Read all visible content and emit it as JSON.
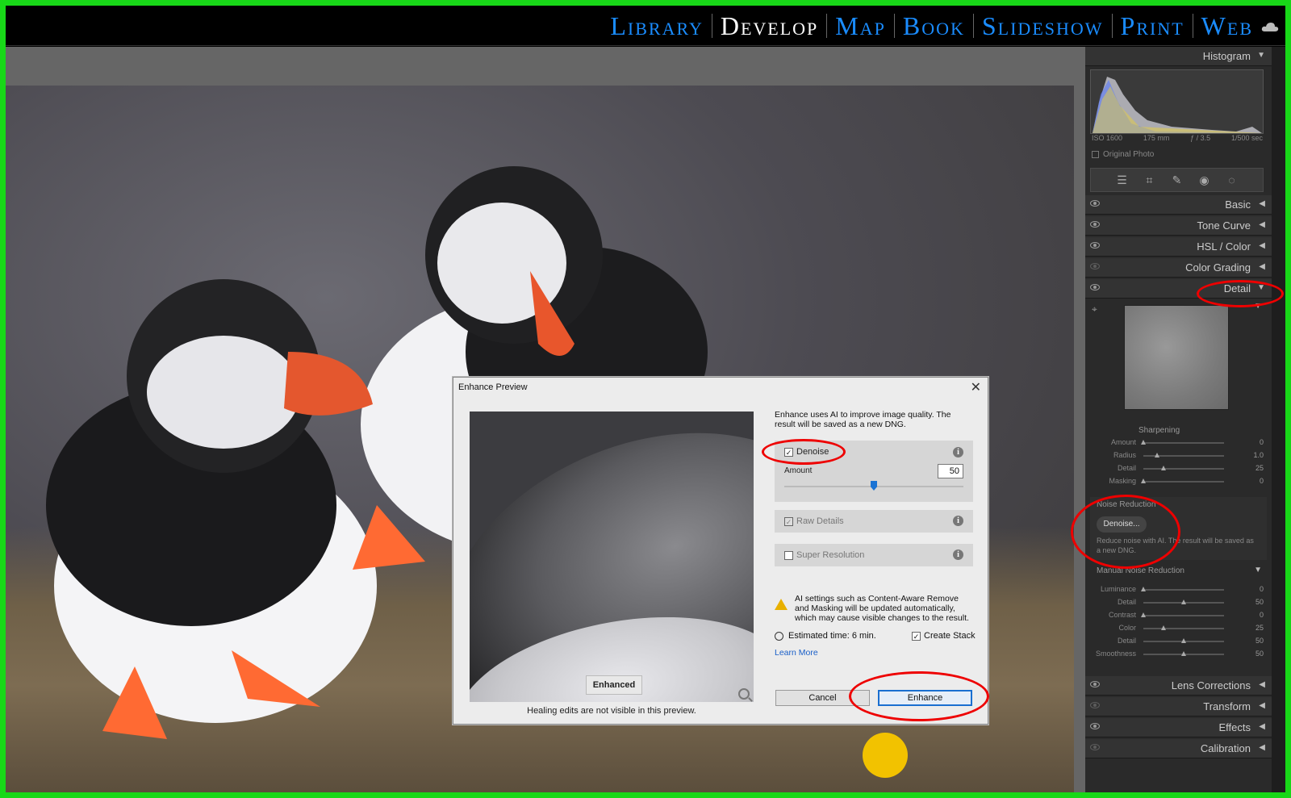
{
  "modules": [
    "Library",
    "Develop",
    "Map",
    "Book",
    "Slideshow",
    "Print",
    "Web"
  ],
  "active_module": "Develop",
  "right_panel": {
    "histogram": {
      "title": "Histogram",
      "iso": "ISO 1600",
      "focal": "175 mm",
      "aperture": "ƒ / 3.5",
      "shutter": "1/500 sec",
      "original_photo": "Original Photo"
    },
    "panels": {
      "basic": "Basic",
      "tone_curve": "Tone Curve",
      "hsl": "HSL / Color",
      "color_grading": "Color Grading",
      "detail": "Detail",
      "lens": "Lens Corrections",
      "transform": "Transform",
      "effects": "Effects",
      "calibration": "Calibration"
    },
    "sharpening": {
      "title": "Sharpening",
      "rows": [
        {
          "label": "Amount",
          "value": "0",
          "fraction": 0
        },
        {
          "label": "Radius",
          "value": "1.0",
          "fraction": 0.17
        },
        {
          "label": "Detail",
          "value": "25",
          "fraction": 0.25
        },
        {
          "label": "Masking",
          "value": "0",
          "fraction": 0
        }
      ]
    },
    "noise_reduction": {
      "title": "Noise Reduction",
      "button": "Denoise...",
      "description": "Reduce noise with AI. The result will be saved as a new DNG."
    },
    "manual_nr": {
      "title": "Manual Noise Reduction",
      "rows": [
        {
          "label": "Luminance",
          "value": "0",
          "fraction": 0
        },
        {
          "label": "Detail",
          "value": "50",
          "fraction": 0.5
        },
        {
          "label": "Contrast",
          "value": "0",
          "fraction": 0
        },
        {
          "label": "Color",
          "value": "25",
          "fraction": 0.25
        },
        {
          "label": "Detail",
          "value": "50",
          "fraction": 0.5
        },
        {
          "label": "Smoothness",
          "value": "50",
          "fraction": 0.5
        }
      ]
    }
  },
  "dialog": {
    "title": "Enhance Preview",
    "intro": "Enhance uses AI to improve image quality. The result will be saved as a new DNG.",
    "preview_label": "Enhanced",
    "healing_note": "Healing edits are not visible in this preview.",
    "denoise": {
      "label": "Denoise",
      "checked": true,
      "amount_label": "Amount",
      "amount": "50"
    },
    "raw_details": {
      "label": "Raw Details",
      "checked": true
    },
    "super_resolution": {
      "label": "Super Resolution",
      "checked": false
    },
    "warning": "AI settings such as Content-Aware Remove and Masking will be updated automatically, which may cause visible changes to the result.",
    "estimated": "Estimated time: 6 min.",
    "create_stack": "Create Stack",
    "learn_more": "Learn More",
    "cancel": "Cancel",
    "enhance": "Enhance"
  },
  "colors": {
    "frame": "#18d818",
    "module_link": "#1a8cff",
    "annotation": "#e00000",
    "accent": "#1a6fd0"
  }
}
